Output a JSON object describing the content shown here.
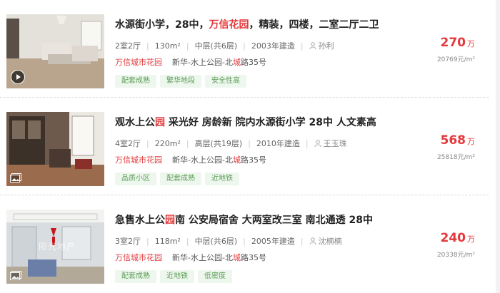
{
  "listings": [
    {
      "title_parts": [
        "水源街小学，28中，",
        "万信花园",
        "，精装，四楼，二室二厅二卫"
      ],
      "layout": "2室2厅",
      "area": "130m²",
      "floor": "中层(共6层)",
      "built": "2003年建造",
      "agent": "孙利",
      "community": "万信城市花园",
      "address_parts": [
        "新华-水上公园-北",
        "城",
        "路35号"
      ],
      "tags": [
        "配套成熟",
        "繁华地段",
        "安全性高"
      ],
      "price": "270",
      "price_unit": "万",
      "unit_price": "20769元/m²",
      "media_icon": "play-icon"
    },
    {
      "title_parts": [
        "观水上公",
        "园",
        " 采光好 房龄新 院内水源街小学 28中 人文素高"
      ],
      "layout": "4室2厅",
      "area": "220m²",
      "floor": "高层(共19层)",
      "built": "2010年建造",
      "agent": "王玉珠",
      "community": "万信城市花园",
      "address_parts": [
        "新华-水上公园-北",
        "城",
        "路35号"
      ],
      "tags": [
        "品质小区",
        "配套成熟",
        "近地铁"
      ],
      "price": "568",
      "price_unit": "万",
      "unit_price": "25818元/m²",
      "media_icon": "gallery-icon"
    },
    {
      "title_parts": [
        "急售水上公",
        "园",
        "南 公安局宿舍 大两室改三室 南北通透 28中"
      ],
      "layout": "3室2厅",
      "area": "118m²",
      "floor": "中层(共6层)",
      "built": "2005年建造",
      "agent": "沈楠楠",
      "community": "万信城市花园",
      "address_parts": [
        "新华-水上公园-北",
        "城",
        "路35号"
      ],
      "tags": [
        "配套成熟",
        "近地铁",
        "低密度"
      ],
      "price": "240",
      "price_unit": "万",
      "unit_price": "20338元/m²",
      "media_icon": "gallery-icon",
      "watermark": "阳光地产"
    }
  ],
  "colors": {
    "highlight": "#e4393c",
    "tag_bg": "#eef7ee",
    "tag_text": "#5c9d57"
  }
}
